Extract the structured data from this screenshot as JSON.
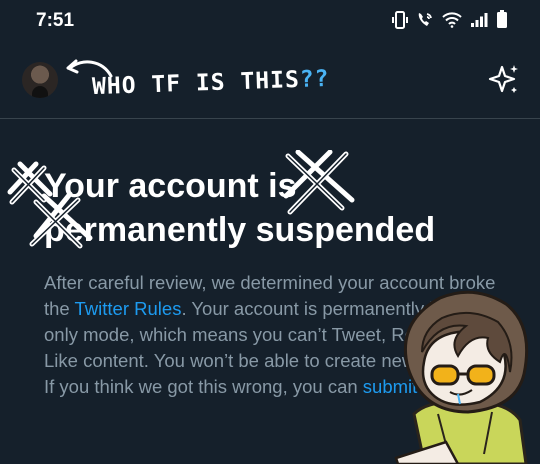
{
  "status_bar": {
    "time": "7:51",
    "icons": [
      "vibrate-icon",
      "wifi-call-icon",
      "wifi-icon",
      "signal-icon",
      "battery-icon"
    ]
  },
  "header": {
    "avatar_icon": "profile-avatar",
    "annotation": "WHO TF IS THIS",
    "annotation_marks": "??",
    "sparkle_icon": "sparkle-icon"
  },
  "notice": {
    "title_line1": "Your account is",
    "title_line2": "permanently suspended",
    "body": {
      "part1": "After careful review, we determined your account broke the ",
      "link1": "Twitter Rules",
      "part2": ". Your account is permanently in read-only mode, which means you can’t Tweet, Retweet, or Like content. You won’t be able to create new accounts. If you think we got this wrong, you can ",
      "link2": "submit an appeal",
      "part3": "."
    }
  },
  "colors": {
    "background": "#15202b",
    "divider": "#38444d",
    "text_secondary": "#8899a6",
    "accent": "#1d9bf0"
  }
}
